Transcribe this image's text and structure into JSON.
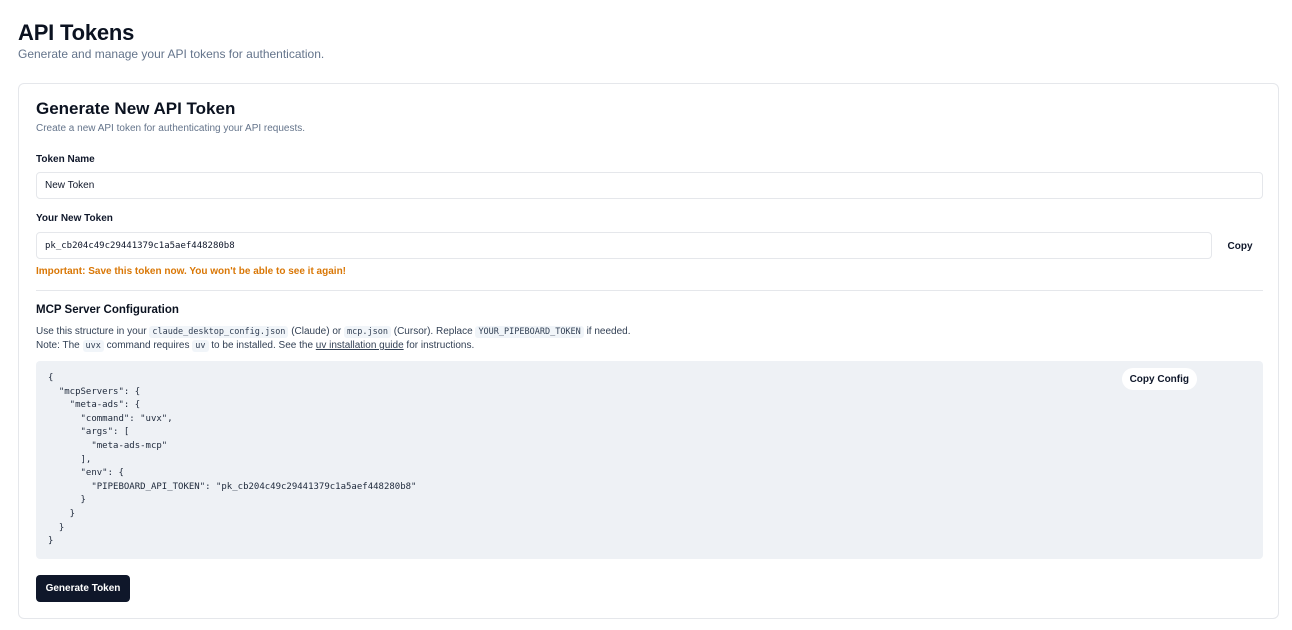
{
  "header": {
    "title": "API Tokens",
    "subtitle": "Generate and manage your API tokens for authentication."
  },
  "card": {
    "title": "Generate New API Token",
    "description": "Create a new API token for authenticating your API requests."
  },
  "token_name": {
    "label": "Token Name",
    "value": "New Token"
  },
  "new_token": {
    "label": "Your New Token",
    "value": "pk_cb204c49c29441379c1a5aef448280b8",
    "copy_label": "Copy",
    "warning": "Important: Save this token now. You won't be able to see it again!"
  },
  "mcp": {
    "title": "MCP Server Configuration",
    "line1": {
      "t1": "Use this structure in your ",
      "c1": "claude_desktop_config.json",
      "t2": " (Claude) or ",
      "c2": "mcp.json",
      "t3": " (Cursor). Replace ",
      "c3": "YOUR_PIPEBOARD_TOKEN",
      "t4": " if needed."
    },
    "line2": {
      "t1": "Note: The ",
      "c1": "uvx",
      "t2": " command requires ",
      "c2": "uv",
      "t3": " to be installed. See the ",
      "link": "uv installation guide",
      "t4": " for instructions."
    },
    "config_code": "{\n  \"mcpServers\": {\n    \"meta-ads\": {\n      \"command\": \"uvx\",\n      \"args\": [\n        \"meta-ads-mcp\"\n      ],\n      \"env\": {\n        \"PIPEBOARD_API_TOKEN\": \"pk_cb204c49c29441379c1a5aef448280b8\"\n      }\n    }\n  }\n}",
    "copy_config_label": "Copy Config"
  },
  "actions": {
    "generate_label": "Generate Token"
  },
  "colors": {
    "primary": "#0f172a",
    "warning": "#d97706",
    "code_bg": "#eef1f5",
    "border": "#e5e7eb"
  }
}
